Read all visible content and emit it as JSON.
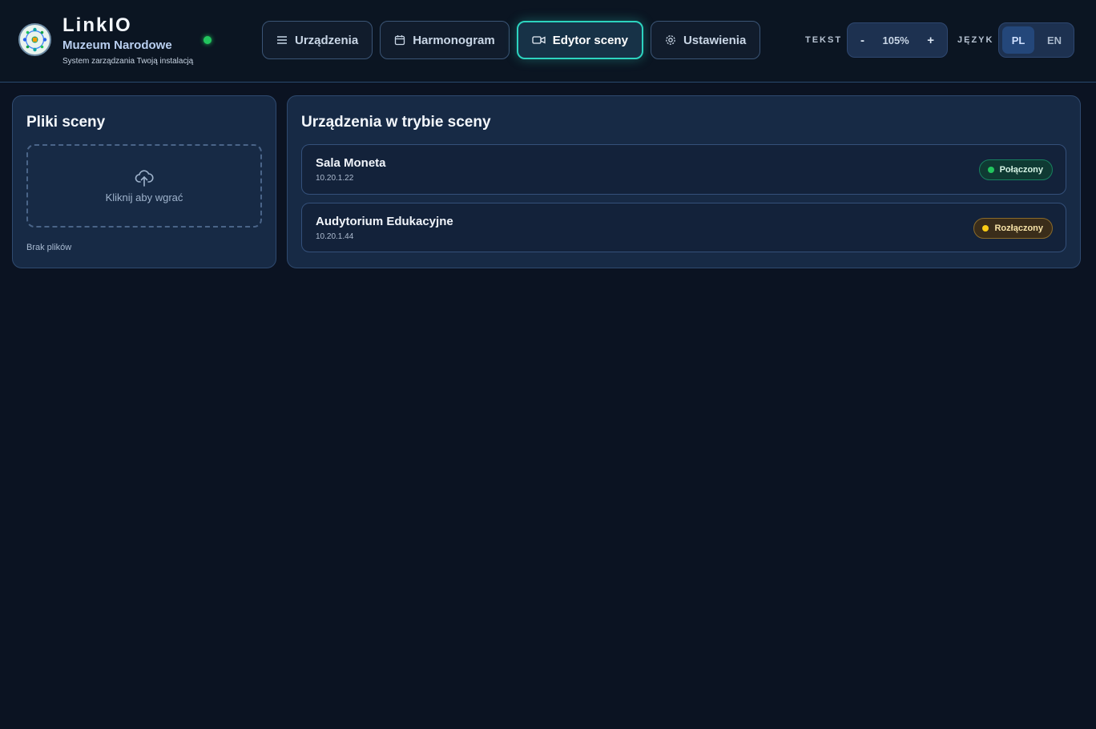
{
  "header": {
    "app_name": "LinkIO",
    "org_name": "Muzeum Narodowe",
    "tagline": "System zarządzania Twoją instalacją",
    "status_color": "#22c55e"
  },
  "nav": {
    "items": [
      {
        "label": "Urządzenia",
        "icon": "list-icon",
        "active": false
      },
      {
        "label": "Harmonogram",
        "icon": "calendar-icon",
        "active": false
      },
      {
        "label": "Edytor sceny",
        "icon": "video-camera-icon",
        "active": true
      },
      {
        "label": "Ustawienia",
        "icon": "gear-icon",
        "active": false
      }
    ]
  },
  "controls": {
    "text_label": "TEKST",
    "decrease": "-",
    "zoom": "105%",
    "increase": "+",
    "language_label": "JĘZYK",
    "languages": [
      {
        "code": "PL",
        "selected": true
      },
      {
        "code": "EN",
        "selected": false
      }
    ]
  },
  "scene_files": {
    "title": "Pliki sceny",
    "upload_text": "Kliknij aby wgrać",
    "upload_icon": "cloud-upload-icon",
    "empty_text": "Brak plików"
  },
  "scene_devices": {
    "title": "Urządzenia w trybie sceny",
    "items": [
      {
        "name": "Sala Moneta",
        "ip": "10.20.1.22",
        "status": "Połączony",
        "status_color": "#22c55e"
      },
      {
        "name": "Audytorium Edukacyjne",
        "ip": "10.20.1.44",
        "status": "Rozłączony",
        "status_color": "#facc15"
      }
    ]
  }
}
